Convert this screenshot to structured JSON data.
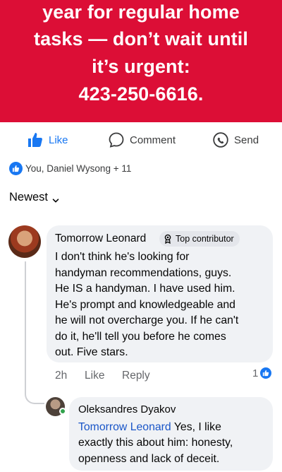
{
  "post": {
    "banner_lines": [
      "year for regular home",
      "tasks — don’t wait until",
      "it’s urgent:",
      "423-250-6616."
    ],
    "banner_color": "#dc0e36"
  },
  "actions": {
    "like_label": "Like",
    "comment_label": "Comment",
    "send_label": "Send",
    "accent": "#1877f2"
  },
  "reactions": {
    "summary": "You, Daniel Wysong + 11"
  },
  "comments": {
    "sort_label": "Newest"
  },
  "comment": {
    "author": "Tomorrow Leonard",
    "badge": "Top contributor",
    "text_lines": [
      "I don't think he's looking for",
      "handyman recommendations, guys.",
      "He IS a handyman. I have used him.",
      "He's prompt and knowledgeable and",
      "he will not overcharge you. If he can't",
      "do it, he'll tell you before he comes",
      "out. Five stars."
    ],
    "time": "2h",
    "like_label": "Like",
    "reply_label": "Reply",
    "like_count": "1"
  },
  "reply": {
    "author": "Oleksandres Dyakov",
    "mention": "Tomorrow Leonard",
    "line1_rest": " Yes, I like",
    "lines": [
      "exactly this about him: honesty,",
      "openness and lack of deceit."
    ]
  }
}
